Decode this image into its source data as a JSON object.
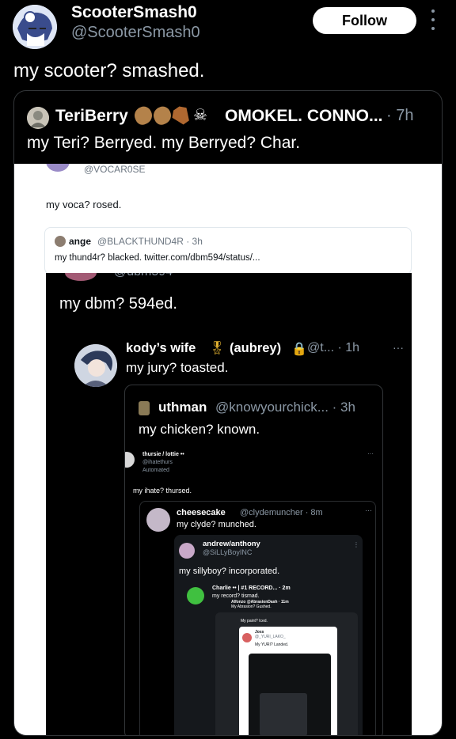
{
  "post": {
    "author_name": "ScooterSmash0",
    "author_handle": "@ScooterSmash0",
    "follow_label": "Follow",
    "text": "my scooter? smashed."
  },
  "quote": {
    "author_name": "TeriBerry",
    "author_name_rest": "OMOKEL. CONNO...",
    "time": "· 7h",
    "text": "my Teri? Berryed. my Berryed? Char.",
    "emoji_icons": [
      "potato-icon",
      "potato-icon",
      "coffin-icon",
      "skull-icon"
    ]
  },
  "nested": {
    "voca": {
      "handle": "@VOCAR0SE",
      "text": "my voca? rosed."
    },
    "ange": {
      "name": "ange",
      "handle": "@BLACKTHUND4R · 3h",
      "text": "my thund4r? blacked. twitter.com/dbm594/status/..."
    },
    "dbm": {
      "cut_handle": "@dbm594",
      "text": "my dbm? 594ed."
    },
    "kody": {
      "name": "kody’s wife",
      "medal": "🎖",
      "name_suffix": "(aubrey)",
      "lock": "🔒",
      "meta": "@t... · 1h",
      "dots": "···",
      "text": "my jury? toasted."
    },
    "uthman": {
      "name": "uthman",
      "meta": "@knowyourchick... · 3h",
      "text": "my chicken? known."
    },
    "thursie": {
      "name": "thursie / lottie ••",
      "handle": "@ihatethurs",
      "automated": "Automated",
      "dots": "···",
      "text": "my ihate? thursed."
    },
    "cheesecake": {
      "name": "cheesecake",
      "handle": "@clydemuncher · 8m",
      "dots": "···",
      "text": "my clyde? munched."
    },
    "andrew": {
      "name": "andrew/anthony",
      "handle": "@SiLLyBoyINC",
      "dots": "⋮",
      "text": "my sillyboy? incorporated."
    },
    "charlie": {
      "name": "Charlie •• | #1 RECORD... · 2m",
      "text": "my record? tismad."
    },
    "alfonzo": {
      "name": "Alfonzo @AbrasionDash · 11m",
      "text": "My Abrasion? Gushed."
    },
    "paint": {
      "text": "My paint? Iced."
    },
    "joss": {
      "name": "Joss",
      "handle": "@_YURI_LAKO_",
      "text": "My YURI? Landed."
    }
  },
  "colors": {
    "background": "#000000",
    "text_primary": "#e7e9ea",
    "text_secondary": "#8b98a5",
    "follow_bg": "#ffffff"
  }
}
